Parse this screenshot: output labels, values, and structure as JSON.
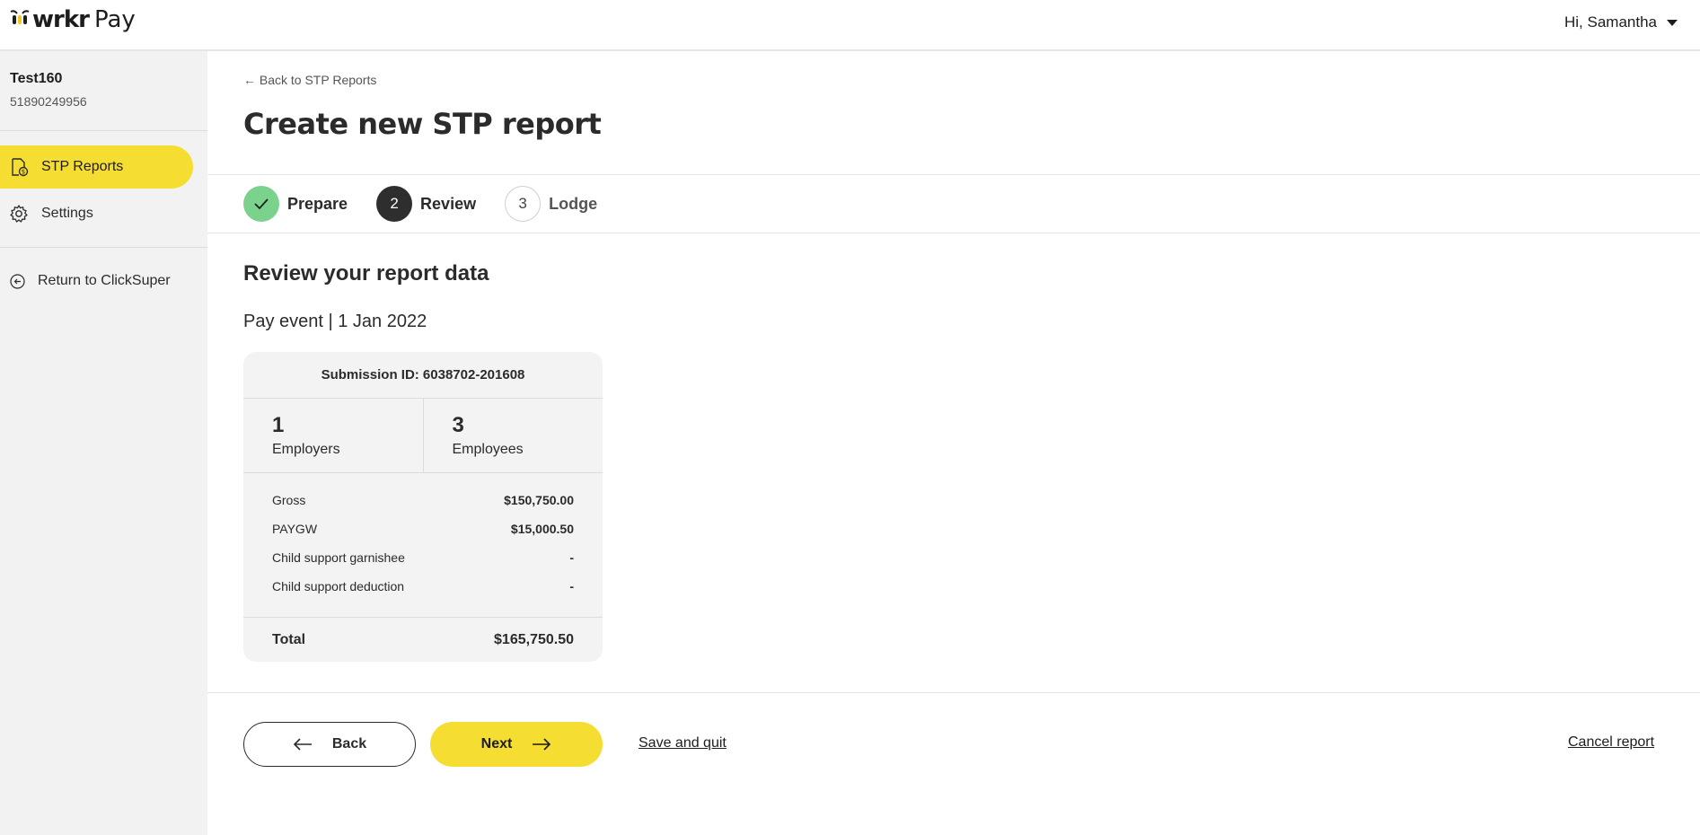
{
  "app": {
    "logo_wordmark": "wrkr",
    "logo_product": "Pay",
    "greeting": "Hi, Samantha",
    "accent_color": "#f6dd32"
  },
  "sidebar": {
    "org_name": "Test160",
    "org_id": "51890249956",
    "items": [
      {
        "label": "STP Reports",
        "icon": "report-dollar-icon",
        "active": true
      },
      {
        "label": "Settings",
        "icon": "gear-icon",
        "active": false
      }
    ],
    "return_link": {
      "label": "Return to ClickSuper",
      "icon": "arrow-left-circle-icon"
    }
  },
  "main": {
    "back_link": "← Back to STP Reports",
    "title": "Create new STP report",
    "steps": [
      {
        "number": "",
        "label": "Prepare",
        "state": "done"
      },
      {
        "number": "2",
        "label": "Review",
        "state": "current"
      },
      {
        "number": "3",
        "label": "Lodge",
        "state": "todo"
      }
    ],
    "section_title": "Review your report data",
    "pay_event": "Pay event | 1 Jan 2022",
    "card": {
      "submission_id": "Submission ID: 6038702-201608",
      "employers_count": "1",
      "employers_label": "Employers",
      "employees_count": "3",
      "employees_label": "Employees",
      "lines": [
        {
          "label": "Gross",
          "value": "$150,750.00"
        },
        {
          "label": "PAYGW",
          "value": "$15,000.50"
        },
        {
          "label": "Child support garnishee",
          "value": "-"
        },
        {
          "label": "Child support deduction",
          "value": "-"
        }
      ],
      "total_label": "Total",
      "total_value": "$165,750.50"
    },
    "actions": {
      "back_label": "Back",
      "next_label": "Next",
      "save_quit_label": "Save and quit",
      "cancel_label": "Cancel report"
    }
  }
}
